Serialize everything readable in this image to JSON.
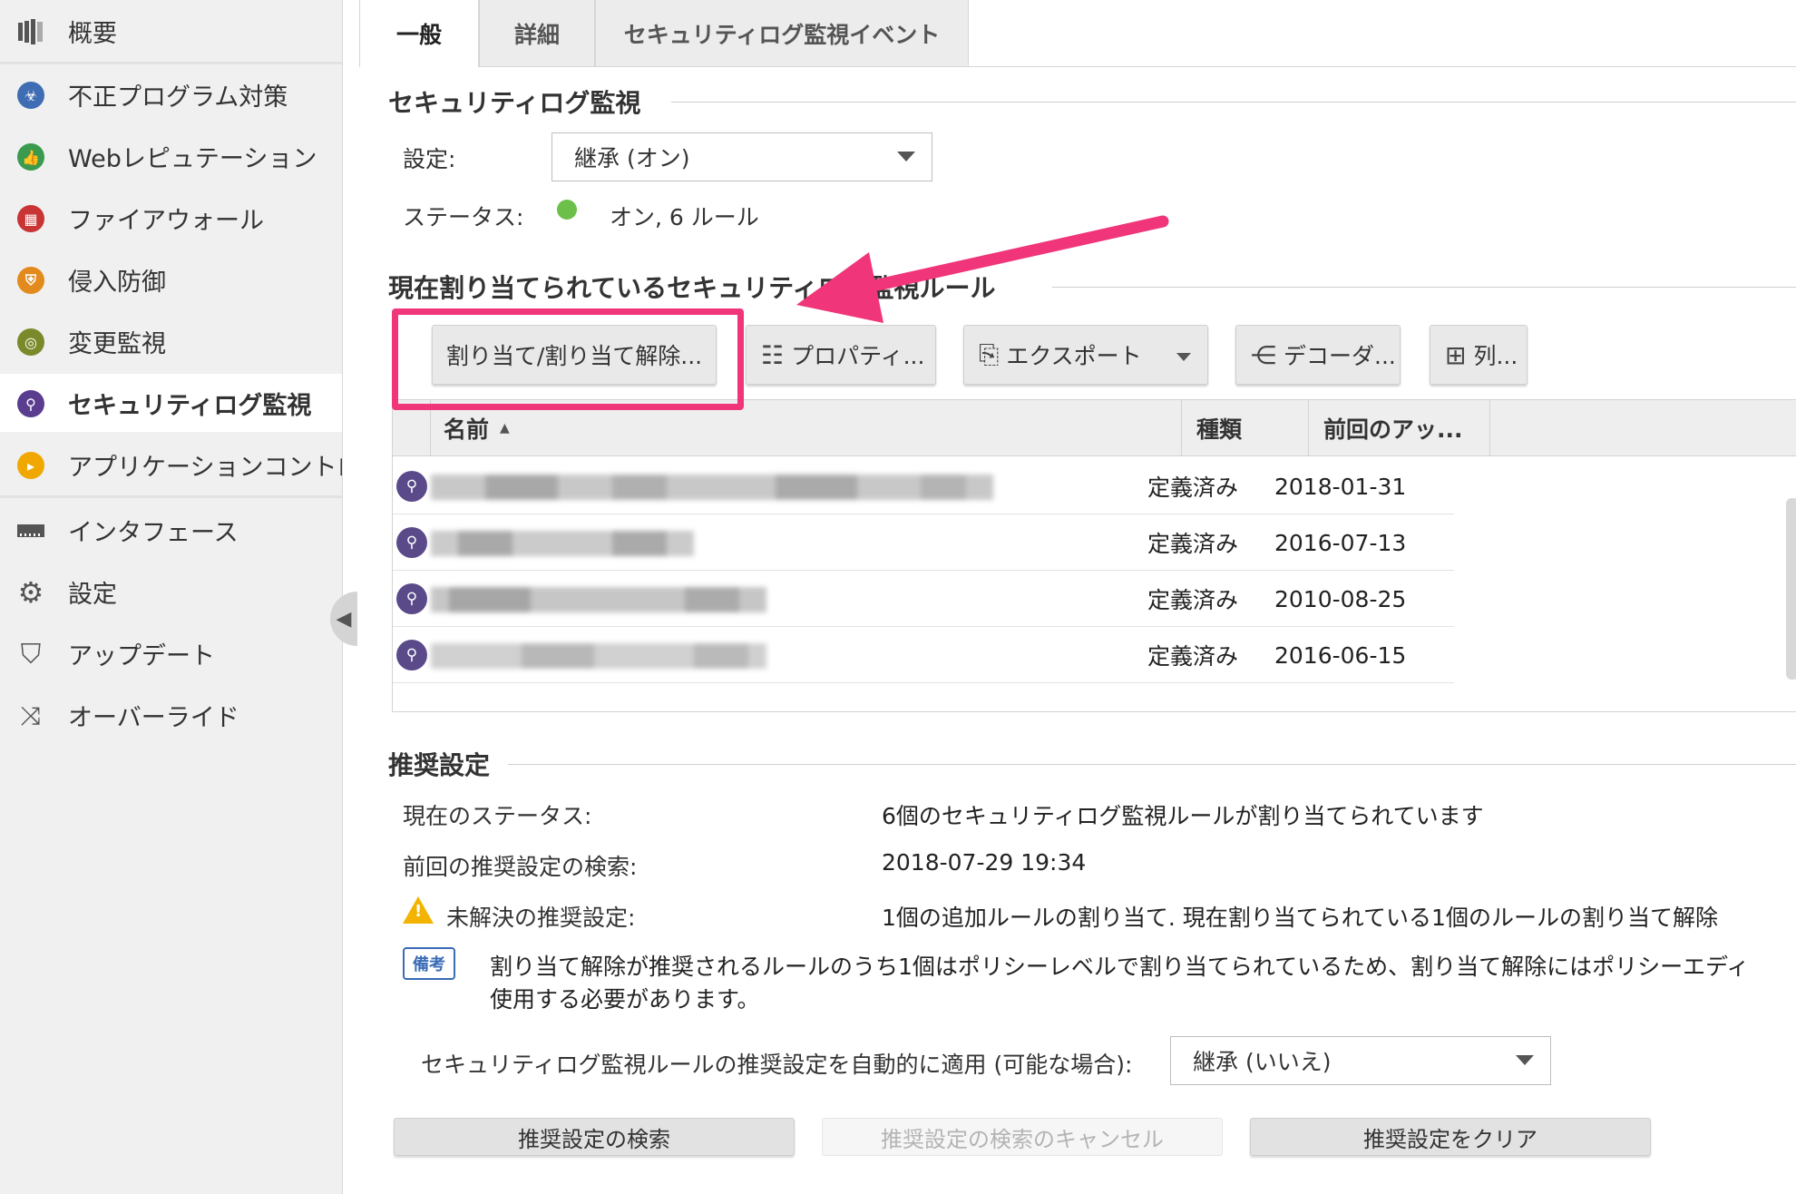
{
  "sidebar": {
    "items": [
      {
        "label": "概要",
        "icon": "dashboard-icon"
      },
      {
        "label": "不正プログラム対策",
        "icon": "biohazard-icon"
      },
      {
        "label": "Webレピュテーション",
        "icon": "thumbs-up-icon"
      },
      {
        "label": "ファイアウォール",
        "icon": "firewall-icon"
      },
      {
        "label": "侵入防御",
        "icon": "intrusion-prevention-icon"
      },
      {
        "label": "変更監視",
        "icon": "fingerprint-icon"
      },
      {
        "label": "セキュリティログ監視",
        "icon": "magnifier-icon",
        "active": true
      },
      {
        "label": "アプリケーションコントロール",
        "icon": "terminal-icon"
      },
      {
        "label": "インタフェース",
        "icon": "network-interface-icon"
      },
      {
        "label": "設定",
        "icon": "gear-icon"
      },
      {
        "label": "アップデート",
        "icon": "shield-update-icon"
      },
      {
        "label": "オーバーライド",
        "icon": "shuffle-icon"
      }
    ]
  },
  "tabs": [
    {
      "label": "一般",
      "active": true
    },
    {
      "label": "詳細"
    },
    {
      "label": "セキュリティログ監視イベント"
    }
  ],
  "log_inspection": {
    "title": "セキュリティログ監視",
    "setting_label": "設定:",
    "setting_value": "継承 (オン)",
    "status_label": "ステータス:",
    "status_value": "オン, 6 ルール",
    "status_color": "#6cc04a"
  },
  "assigned_rules": {
    "title": "現在割り当てられているセキュリティログ監視ルール",
    "toolbar": {
      "assign": "割り当て/割り当て解除...",
      "properties": "プロパティ...",
      "export": "エクスポート",
      "decoders": "デコーダ...",
      "columns": "列..."
    },
    "columns": {
      "name": "名前",
      "type": "種類",
      "last_updated": "前回のアッ..."
    },
    "rows": [
      {
        "type": "定義済み",
        "date": "2018-01-31"
      },
      {
        "type": "定義済み",
        "date": "2016-07-13"
      },
      {
        "type": "定義済み",
        "date": "2010-08-25"
      },
      {
        "type": "定義済み",
        "date": "2016-06-15"
      }
    ]
  },
  "recommendations": {
    "title": "推奨設定",
    "current_status_label": "現在のステータス:",
    "current_status_value": "6個のセキュリティログ監視ルールが割り当てられています",
    "last_scan_label": "前回の推奨設定の検索:",
    "last_scan_value": "2018-07-29 19:34",
    "unresolved_label": "未解決の推奨設定:",
    "unresolved_value": "1個の追加ルールの割り当て. 現在割り当てられている1個のルールの割り当て解除",
    "note_badge": "備考",
    "note_line1": "割り当て解除が推奨されるルールのうち1個はポリシーレベルで割り当てられているため、割り当て解除にはポリシーエディ",
    "note_line2": "使用する必要があります。",
    "auto_apply_label": "セキュリティログ監視ルールの推奨設定を自動的に適用 (可能な場合):",
    "auto_apply_value": "継承 (いいえ)",
    "buttons": {
      "scan": "推奨設定の検索",
      "cancel_scan": "推奨設定の検索のキャンセル",
      "clear": "推奨設定をクリア"
    }
  },
  "accent_color": "#f0357a"
}
